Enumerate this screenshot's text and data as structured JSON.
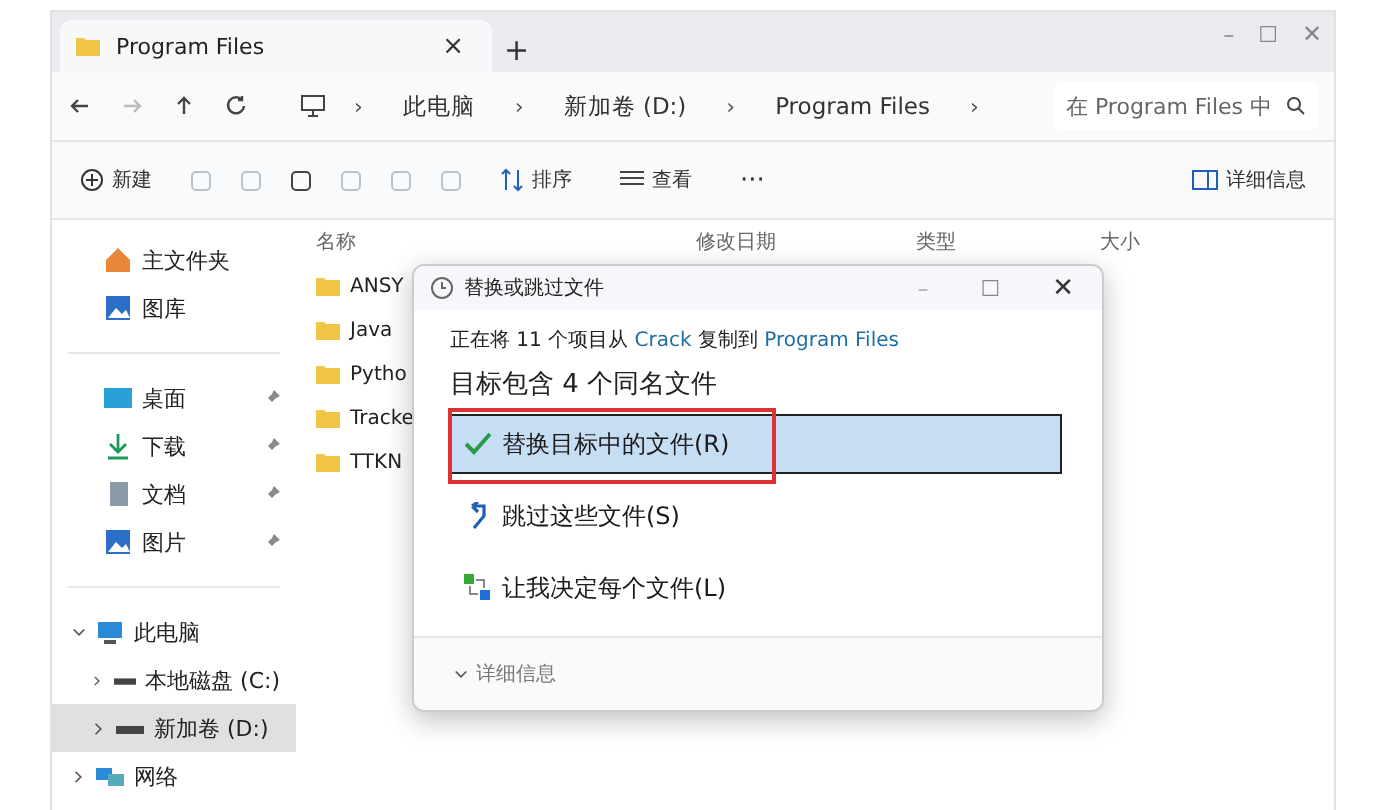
{
  "tab": {
    "title": "Program Files",
    "close": "×",
    "add": "+"
  },
  "window_controls": {
    "minimize": "–",
    "maximize": "☐",
    "close": "✕"
  },
  "address": {
    "separator": "›",
    "crumbs": [
      "此电脑",
      "新加卷 (D:)",
      "Program Files"
    ],
    "search_placeholder": "在 Program Files 中"
  },
  "toolbar": {
    "new": "新建",
    "sort": "排序",
    "view": "查看",
    "more": "···",
    "details": "详细信息"
  },
  "sidebar": {
    "quick": [
      {
        "label": "主文件夹",
        "kind": "home"
      },
      {
        "label": "图库",
        "kind": "gallery"
      }
    ],
    "pinned": [
      {
        "label": "桌面",
        "kind": "desktop",
        "pinned": true
      },
      {
        "label": "下载",
        "kind": "download",
        "pinned": true
      },
      {
        "label": "文档",
        "kind": "document",
        "pinned": true
      },
      {
        "label": "图片",
        "kind": "gallery",
        "pinned": true
      }
    ],
    "tree": [
      {
        "label": "此电脑",
        "kind": "pc",
        "expanded": true,
        "selected": false,
        "children": [
          {
            "label": "本地磁盘 (C:)",
            "kind": "drive",
            "expanded": false,
            "selected": false
          },
          {
            "label": "新加卷 (D:)",
            "kind": "drive",
            "expanded": false,
            "selected": true
          }
        ]
      },
      {
        "label": "网络",
        "kind": "network",
        "expanded": false,
        "selected": false
      }
    ]
  },
  "table": {
    "columns": [
      "名称",
      "修改日期",
      "类型",
      "大小"
    ],
    "rows": [
      "ANSY",
      "Java",
      "Pytho",
      "Tracke",
      "TTKN"
    ]
  },
  "dialog": {
    "title": "替换或跳过文件",
    "progress": "正在将 11 个项目从 **Crack** 复制到 **Program Files**",
    "heading": "目标包含 4 个同名文件",
    "options": [
      {
        "label": "替换目标中的文件(R)",
        "kind": "replace",
        "selected": true,
        "annotated": true
      },
      {
        "label": "跳过这些文件(S)",
        "kind": "skip",
        "selected": false,
        "annotated": false
      },
      {
        "label": "让我决定每个文件(L)",
        "kind": "decide",
        "selected": false,
        "annotated": false
      }
    ],
    "details": "详细信息",
    "expanded": false
  }
}
